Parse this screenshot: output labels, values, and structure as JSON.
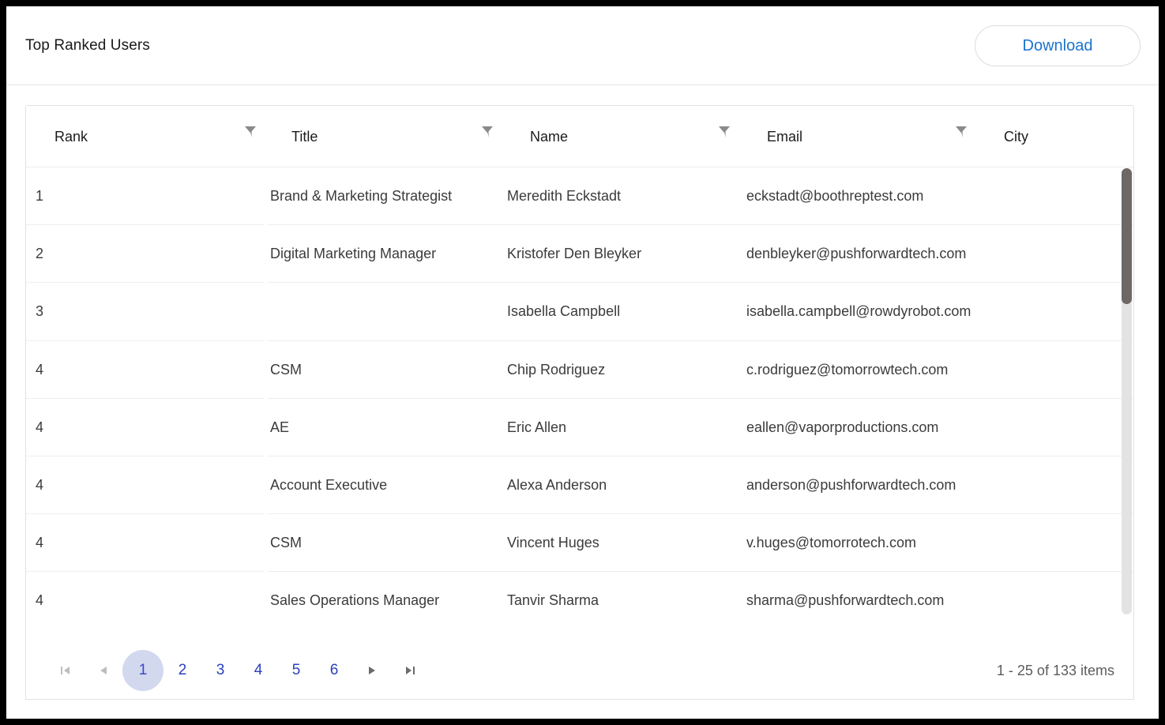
{
  "card": {
    "title": "Top Ranked Users",
    "download_label": "Download"
  },
  "grid": {
    "columns": [
      {
        "key": "rank",
        "label": "Rank",
        "filter_icon": "filter-funnel-icon"
      },
      {
        "key": "title",
        "label": "Title",
        "filter_icon": "filter-funnel-icon"
      },
      {
        "key": "name",
        "label": "Name",
        "filter_icon": "filter-funnel-icon"
      },
      {
        "key": "email",
        "label": "Email",
        "filter_icon": "filter-funnel-icon"
      },
      {
        "key": "city",
        "label": "City",
        "filter_icon": null
      }
    ],
    "rows": [
      {
        "rank": "1",
        "title": "Brand & Marketing Strategist",
        "name": "Meredith Eckstadt",
        "email": "eckstadt@boothreptest.com",
        "city": ""
      },
      {
        "rank": "2",
        "title": "Digital Marketing Manager",
        "name": "Kristofer Den Bleyker",
        "email": "denbleyker@pushforwardtech.com",
        "city": ""
      },
      {
        "rank": "3",
        "title": "",
        "name": "Isabella Campbell",
        "email": "isabella.campbell@rowdyrobot.com",
        "city": ""
      },
      {
        "rank": "4",
        "title": "CSM",
        "name": "Chip Rodriguez",
        "email": "c.rodriguez@tomorrowtech.com",
        "city": ""
      },
      {
        "rank": "4",
        "title": "AE",
        "name": "Eric Allen",
        "email": "eallen@vaporproductions.com",
        "city": ""
      },
      {
        "rank": "4",
        "title": "Account Executive",
        "name": "Alexa Anderson",
        "email": "anderson@pushforwardtech.com",
        "city": ""
      },
      {
        "rank": "4",
        "title": "CSM",
        "name": "Vincent Huges",
        "email": "v.huges@tomorrotech.com",
        "city": ""
      },
      {
        "rank": "4",
        "title": "Sales Operations Manager",
        "name": "Tanvir Sharma",
        "email": "sharma@pushforwardtech.com",
        "city": ""
      }
    ],
    "vertical_scrollbar": {
      "name": "vertical-scrollbar",
      "thumb_position_pct": 0,
      "thumb_size_pct": 30
    },
    "horizontal_scrollbar": {
      "name": "horizontal-scrollbar",
      "thumb_position_pct": 0,
      "thumb_size_pct": 51
    }
  },
  "pager": {
    "first_icon": "first-page-icon",
    "prev_icon": "previous-page-icon",
    "next_icon": "next-page-icon",
    "last_icon": "last-page-icon",
    "pages": [
      "1",
      "2",
      "3",
      "4",
      "5",
      "6"
    ],
    "active_page": "1",
    "first_disabled": true,
    "prev_disabled": true,
    "next_disabled": false,
    "last_disabled": false,
    "summary": "1 - 25 of 133 items"
  },
  "colors": {
    "accent_link": "#1a73cf",
    "pager_active_bg": "#d2d8ee",
    "pager_active_text": "#3a49c9",
    "scrollbar_thumb": "#6d6866",
    "scrollbar_track": "#e3e3e3"
  }
}
